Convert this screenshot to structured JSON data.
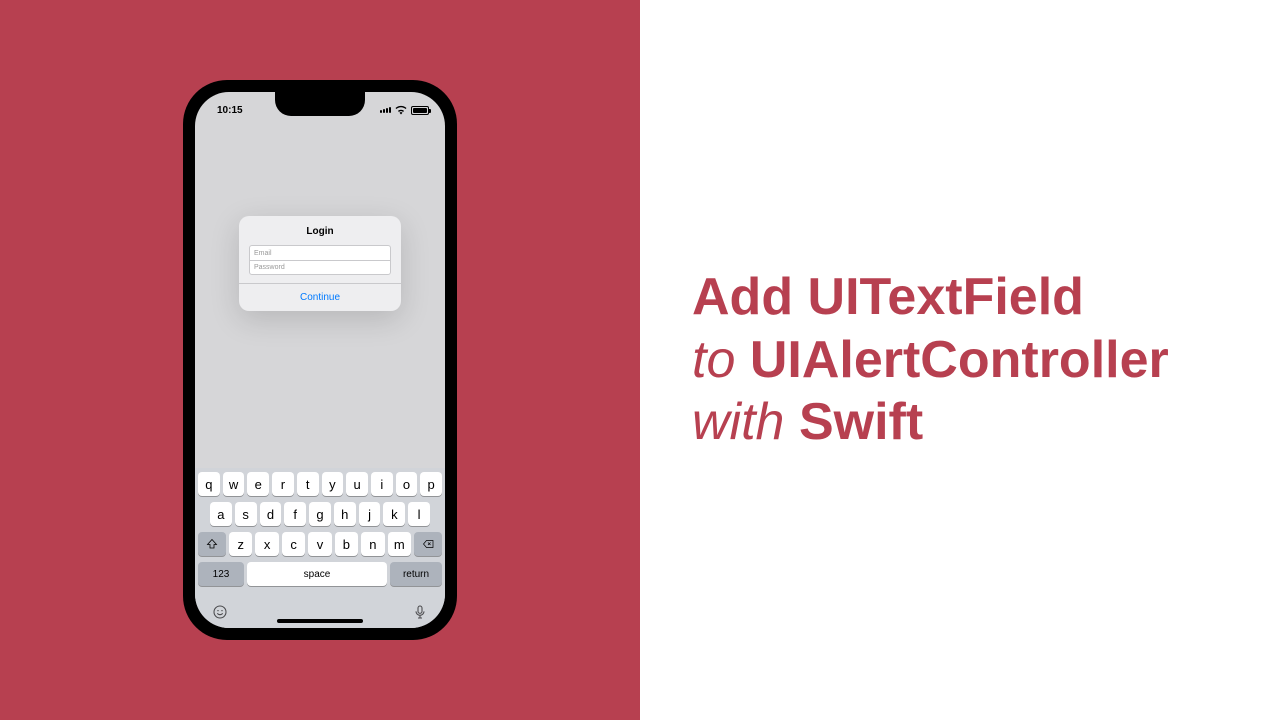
{
  "headline": {
    "line1_bold": "Add UITextField",
    "line2_italic": "to",
    "line2_bold": "UIAlertController",
    "line3_italic": "with",
    "line3_bold": "Swift"
  },
  "phone": {
    "status": {
      "time": "10:15"
    },
    "alert": {
      "title": "Login",
      "email_placeholder": "Email",
      "password_placeholder": "Password",
      "continue_label": "Continue"
    },
    "keyboard": {
      "row1": [
        "q",
        "w",
        "e",
        "r",
        "t",
        "y",
        "u",
        "i",
        "o",
        "p"
      ],
      "row2": [
        "a",
        "s",
        "d",
        "f",
        "g",
        "h",
        "j",
        "k",
        "l"
      ],
      "row3": [
        "z",
        "x",
        "c",
        "v",
        "b",
        "n",
        "m"
      ],
      "numeric_label": "123",
      "space_label": "space",
      "return_label": "return"
    }
  }
}
